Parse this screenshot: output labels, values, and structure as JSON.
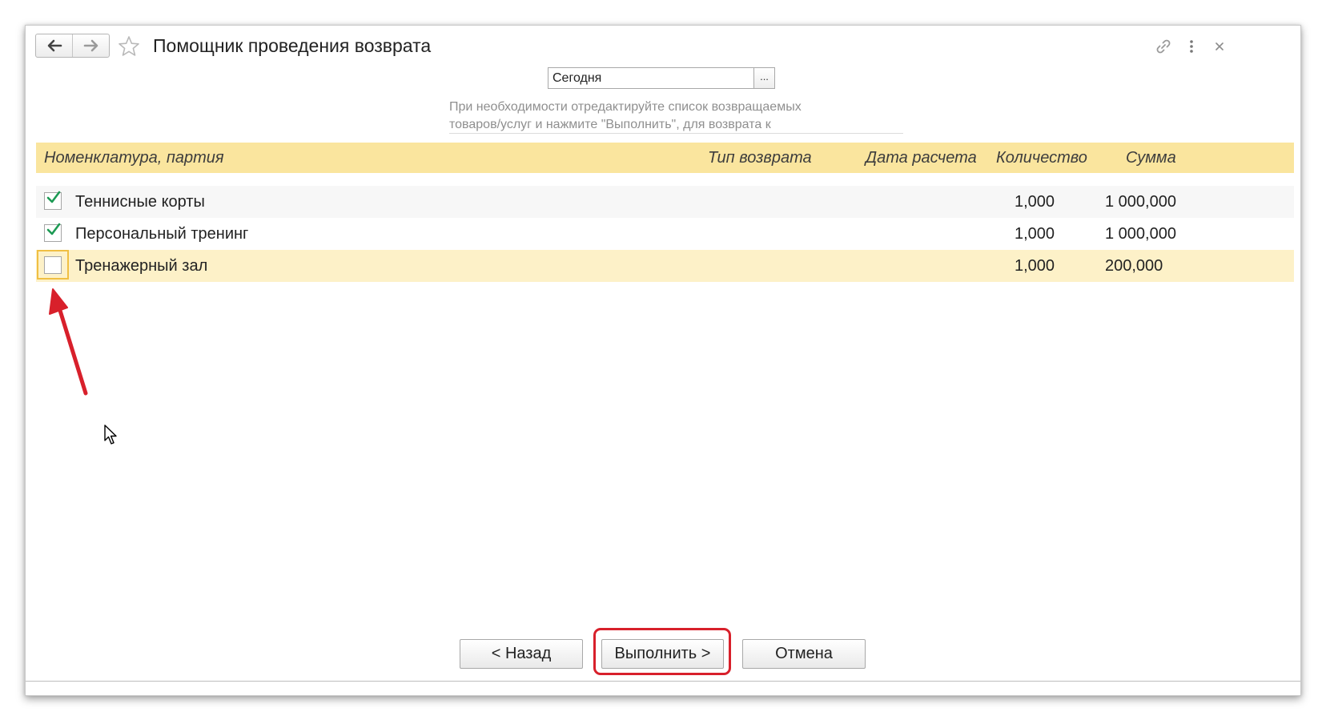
{
  "window": {
    "title": "Помощник проведения возврата",
    "icons": {
      "back": "arrow-left-icon",
      "forward": "arrow-right-icon",
      "favorite": "star-icon",
      "link": "link-icon",
      "menu": "more-vertical-icon",
      "close": "close-icon"
    }
  },
  "form": {
    "date_value": "Сегодня",
    "date_button_label": "...",
    "hint_lines": [
      "При необходимости отредактируйте список возвращаемых",
      "товаров/услуг и нажмите \"Выполнить\", для возврата к"
    ]
  },
  "table": {
    "columns": [
      "Номенклатура, партия",
      "Тип возврата",
      "Дата расчета",
      "Количество",
      "Сумма"
    ],
    "rows": [
      {
        "checked": true,
        "name": "Теннисные корты",
        "return_type": "",
        "calc_date": "",
        "quantity": "1,000",
        "sum": "1 000,000"
      },
      {
        "checked": true,
        "name": "Персональный тренинг",
        "return_type": "",
        "calc_date": "",
        "quantity": "1,000",
        "sum": "1 000,000"
      },
      {
        "checked": false,
        "name": "Тренажерный зал",
        "return_type": "",
        "calc_date": "",
        "quantity": "1,000",
        "sum": "200,000",
        "selected": true
      }
    ]
  },
  "buttons": {
    "back": "< Назад",
    "execute": "Выполнить >",
    "cancel": "Отмена"
  },
  "colors": {
    "header_bg": "#fae59e",
    "selected_row_bg": "#fdf1c8",
    "check_green": "#1d9a54",
    "annotation_red": "#d8202b"
  }
}
